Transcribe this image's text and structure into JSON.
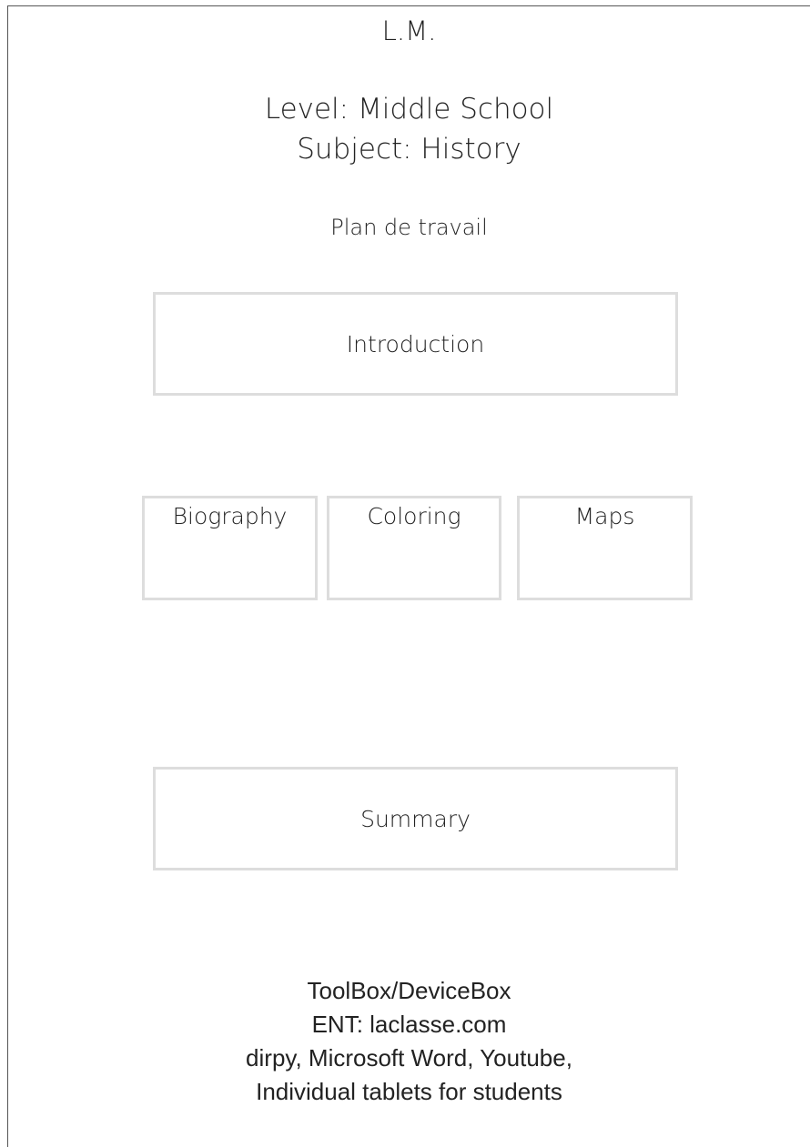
{
  "header": {
    "author": "L.M.",
    "level": "Level: Middle School",
    "subject": "Subject: History",
    "plan_title": "Plan de travail"
  },
  "sections": {
    "introduction": "Introduction",
    "activities": [
      "Biography",
      "Coloring",
      "Maps"
    ],
    "summary": "Summary"
  },
  "toolbox": {
    "lines": [
      "ToolBox/DeviceBox",
      "ENT: laclasse.com",
      "dirpy, Microsoft Word, Youtube,",
      "Individual tablets for students"
    ]
  }
}
